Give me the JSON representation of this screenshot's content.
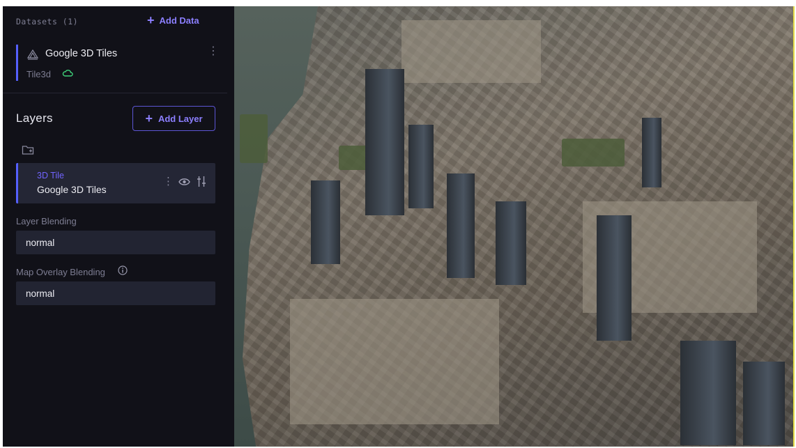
{
  "datasets": {
    "title": "Datasets (1)",
    "add_label": "Add Data",
    "items": [
      {
        "name": "Google 3D Tiles",
        "type": "Tile3d",
        "icon": "layers-icon",
        "status_icon": "cloud-icon"
      }
    ]
  },
  "layers": {
    "title": "Layers",
    "add_label": "Add Layer",
    "items": [
      {
        "type": "3D Tile",
        "name": "Google 3D Tiles"
      }
    ]
  },
  "layer_blending": {
    "label": "Layer Blending",
    "value": "normal"
  },
  "map_overlay_blending": {
    "label": "Map Overlay Blending",
    "value": "normal"
  },
  "colors": {
    "sidebar_bg": "#111118",
    "accent": "#8c7fff",
    "card_bg": "#242635",
    "cloud_status": "#3fd17a"
  }
}
